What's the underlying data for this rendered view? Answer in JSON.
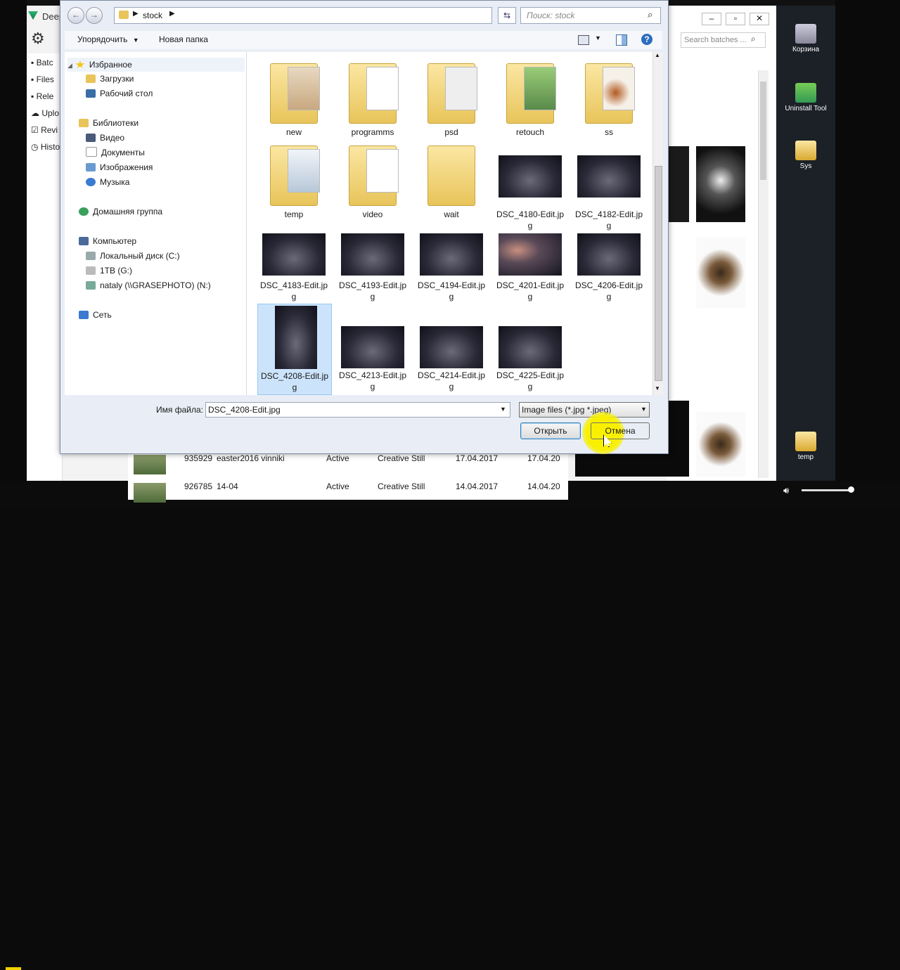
{
  "dialog": {
    "breadcrumb": [
      "stock"
    ],
    "search_placeholder": "Поиск: stock",
    "toolbar": {
      "organize": "Упорядочить",
      "new_folder": "Новая папка"
    },
    "nav": {
      "favorites": "Избранное",
      "downloads": "Загрузки",
      "desktop": "Рабочий стол",
      "libraries": "Библиотеки",
      "video": "Видео",
      "documents": "Документы",
      "images": "Изображения",
      "music": "Музыка",
      "homegroup": "Домашняя группа",
      "computer": "Компьютер",
      "local_disk": "Локальный диск (C:)",
      "drive_g": "1TB (G:)",
      "drive_n": "nataly (\\\\GRASEPHOTO) (N:)",
      "network": "Сеть"
    },
    "folders": [
      "new",
      "programms",
      "psd",
      "retouch",
      "ss",
      "temp",
      "video",
      "wait"
    ],
    "files": [
      {
        "name1": "DSC_4180-Edit.jp",
        "name2": "g"
      },
      {
        "name1": "DSC_4182-Edit.jp",
        "name2": "g"
      },
      {
        "name1": "DSC_4183-Edit.jp",
        "name2": "g"
      },
      {
        "name1": "DSC_4193-Edit.jp",
        "name2": "g"
      },
      {
        "name1": "DSC_4194-Edit.jp",
        "name2": "g"
      },
      {
        "name1": "DSC_4201-Edit.jp",
        "name2": "g"
      },
      {
        "name1": "DSC_4206-Edit.jp",
        "name2": "g"
      },
      {
        "name1": "DSC_4208-Edit.jp",
        "name2": "g"
      },
      {
        "name1": "DSC_4213-Edit.jp",
        "name2": "g"
      },
      {
        "name1": "DSC_4214-Edit.jp",
        "name2": "g"
      },
      {
        "name1": "DSC_4225-Edit.jp",
        "name2": "g"
      }
    ],
    "filename_label": "Имя файла:",
    "filename_value": "DSC_4208-Edit.jpg",
    "filter_value": "Image files (*.jpg *.jpeg)",
    "open_button": "Открыть",
    "cancel_button": "Отмена"
  },
  "bg_app": {
    "title_fragment": "Deep",
    "sidebar": [
      "Batc",
      "Files",
      "Rele",
      "Uplo",
      "Revi",
      "Histo"
    ],
    "search_placeholder": "Search batches ...",
    "rows": [
      {
        "id": "935929",
        "name": "easter2016 vinniki",
        "status": "Active",
        "type": "Creative Still",
        "date1": "17.04.2017",
        "date2": "17.04.20"
      },
      {
        "id": "926785",
        "name": "14-04",
        "status": "Active",
        "type": "Creative Still",
        "date1": "14.04.2017",
        "date2": "14.04.20"
      }
    ]
  },
  "desktop": {
    "icons": [
      "Корзина",
      "Uninstall Tool",
      "Sys",
      "temp"
    ]
  }
}
